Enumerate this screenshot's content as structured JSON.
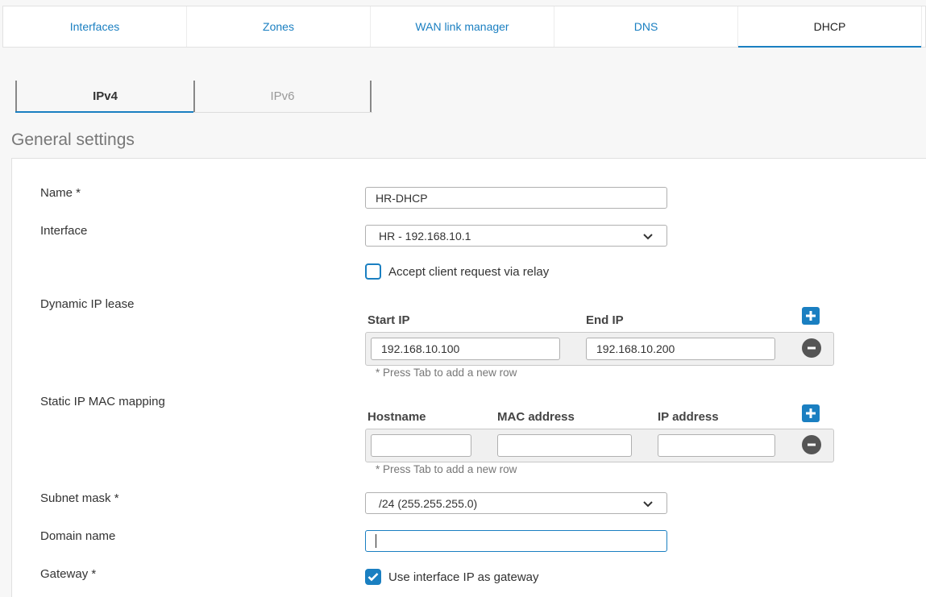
{
  "top_tabs": [
    {
      "label": "Interfaces",
      "active": false
    },
    {
      "label": "Zones",
      "active": false
    },
    {
      "label": "WAN link manager",
      "active": false
    },
    {
      "label": "DNS",
      "active": false
    },
    {
      "label": "DHCP",
      "active": true
    }
  ],
  "sub_tabs": [
    {
      "label": "IPv4",
      "active": true
    },
    {
      "label": "IPv6",
      "active": false
    }
  ],
  "section_title": "General settings",
  "form": {
    "name_label": "Name *",
    "name_value": "HR-DHCP",
    "interface_label": "Interface",
    "interface_value": "HR - 192.168.10.1",
    "relay_label": "Accept client request via relay",
    "relay_checked": false,
    "dynamic_label": "Dynamic IP lease",
    "dynamic_cols": {
      "start": "Start IP",
      "end": "End IP"
    },
    "dynamic_row": {
      "start": "192.168.10.100",
      "end": "192.168.10.200"
    },
    "dynamic_hint": "* Press Tab to add a new row",
    "static_label": "Static IP MAC mapping",
    "static_cols": {
      "hostname": "Hostname",
      "mac": "MAC address",
      "ip": "IP address"
    },
    "static_row": {
      "hostname": "",
      "mac": "",
      "ip": ""
    },
    "static_hint": "* Press Tab to add a new row",
    "subnet_label": "Subnet mask *",
    "subnet_value": "/24 (255.255.255.0)",
    "domain_label": "Domain name",
    "domain_value": "",
    "gateway_label": "Gateway *",
    "gateway_option_label": "Use interface IP as gateway",
    "gateway_checked": true
  },
  "colors": {
    "accent": "#1a7fc1",
    "remove": "#555555"
  }
}
